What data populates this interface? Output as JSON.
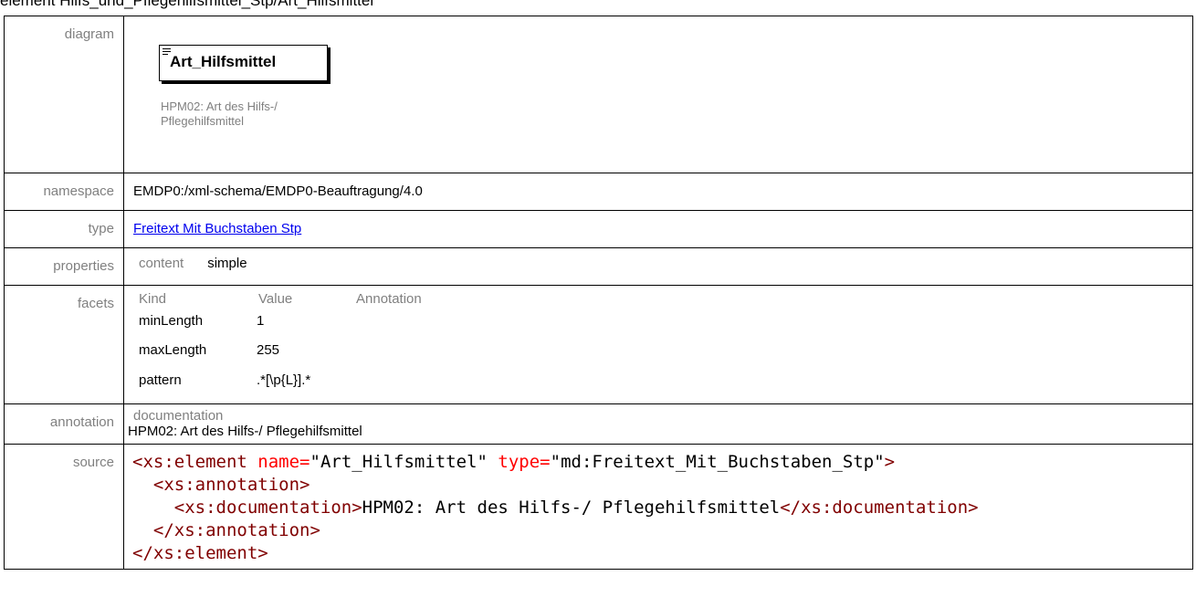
{
  "page_title": "element Hilfs_und_Pflegehilfsmittel_Stp/Art_Hilfsmittel",
  "labels": {
    "diagram": "diagram",
    "namespace": "namespace",
    "type": "type",
    "properties": "properties",
    "facets": "facets",
    "annotation": "annotation",
    "source": "source"
  },
  "diagram": {
    "element_name": "Art_Hilfsmittel",
    "doc_line1": "HPM02: Art des Hilfs-/",
    "doc_line2": "Pflegehilfsmittel"
  },
  "namespace": "EMDP0:/xml-schema/EMDP0-Beauftragung/4.0",
  "type": {
    "link_text": "Freitext Mit Buchstaben Stp"
  },
  "properties": {
    "key": "content",
    "value": "simple"
  },
  "facets": {
    "headers": [
      "Kind",
      "Value",
      "Annotation"
    ],
    "rows": [
      {
        "kind": "minLength",
        "value": "1"
      },
      {
        "kind": "maxLength",
        "value": "255"
      },
      {
        "kind": "pattern",
        "value": ".*[\\p{L}].*"
      }
    ]
  },
  "annotation": {
    "key": "documentation",
    "text": "HPM02: Art des Hilfs-/ Pflegehilfsmittel"
  },
  "source": {
    "l1_open": "<xs:element",
    "l1_attr1": "name=",
    "l1_val1": "\"Art_Hilfsmittel\"",
    "l1_attr2": "type=",
    "l1_val2": "\"md:Freitext_Mit_Buchstaben_Stp\"",
    "l1_close": ">",
    "l2": "<xs:annotation>",
    "l3_open": "<xs:documentation>",
    "l3_text": "HPM02: Art des Hilfs-/ Pflegehilfsmittel",
    "l3_close": "</xs:documentation>",
    "l4": "</xs:annotation>",
    "l5": "</xs:element>"
  }
}
